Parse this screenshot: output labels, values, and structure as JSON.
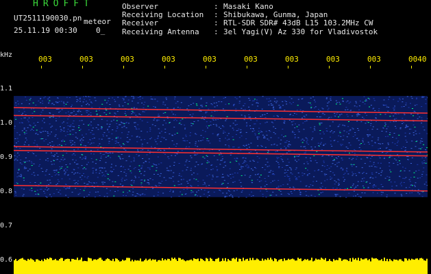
{
  "header": {
    "app_title": "HROFFT",
    "filename": "UT2511190030.pn",
    "file_type": "meteor",
    "date_time": "25.11.19 00:30",
    "index": "0_"
  },
  "station": [
    {
      "key": "Observer",
      "value": "Masaki Kano"
    },
    {
      "key": "Receiving Location",
      "value": "Shibukawa, Gunma, Japan"
    },
    {
      "key": "Receiver",
      "value": "RTL-SDR SDR# 43dB L15 103.2MHz CW"
    },
    {
      "key": "Receiving Antenna",
      "value": "3el Yagi(V) Az 330 for Vladivostok"
    }
  ],
  "axis": {
    "unit": "kHz",
    "time_ticks": [
      "003",
      "003",
      "003",
      "003",
      "003",
      "003",
      "003",
      "003",
      "003",
      "0040"
    ],
    "freq_ticks": [
      "1.1",
      "1.0",
      "0.9",
      "0.8",
      "0.7",
      "0.6"
    ]
  },
  "chart_data": {
    "type": "heatmap",
    "ylabel": "kHz",
    "ylim": [
      0.6,
      1.1
    ],
    "noise_band_khz": [
      0.78,
      1.04
    ],
    "carrier_lines_khz": [
      0.81,
      0.9,
      0.91,
      0.99,
      1.01
    ],
    "colors": {
      "background": "#000000",
      "noise": "#1e3cb4",
      "signal": "#00ff88",
      "carrier": "#ff3030",
      "level": "#ffee00"
    }
  }
}
